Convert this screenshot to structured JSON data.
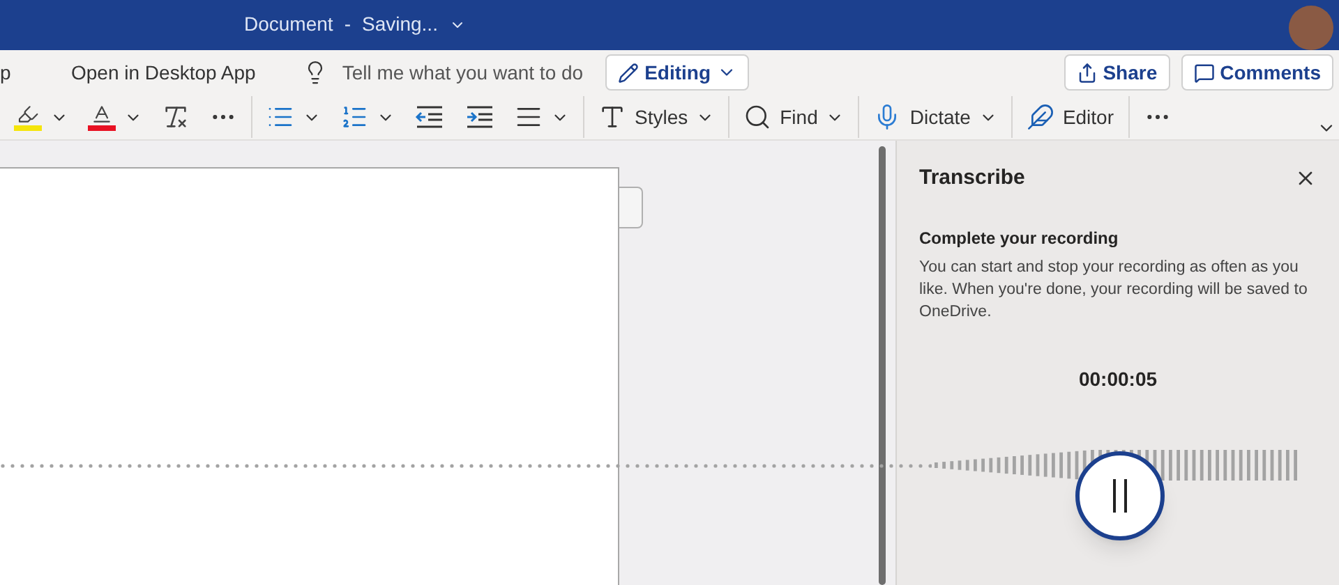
{
  "title_bar": {
    "document": "Document",
    "separator": "-",
    "status": "Saving..."
  },
  "ribbon": {
    "cut_tab": "p",
    "open_desktop": "Open in Desktop App",
    "tell_me": "Tell me what you want to do",
    "mode": "Editing",
    "share": "Share",
    "comments": "Comments"
  },
  "toolbar": {
    "groups": [
      [
        {
          "kind": "highlight",
          "dropdown": true
        },
        {
          "kind": "font-color",
          "dropdown": true
        },
        {
          "kind": "clear-format",
          "dropdown": false
        },
        {
          "kind": "more",
          "dropdown": false
        }
      ],
      [
        {
          "kind": "bullets",
          "dropdown": true
        },
        {
          "kind": "numbering",
          "dropdown": true
        },
        {
          "kind": "outdent",
          "dropdown": false
        },
        {
          "kind": "indent",
          "dropdown": false
        },
        {
          "kind": "align",
          "dropdown": true
        }
      ],
      [
        {
          "kind": "styles",
          "label": "Styles",
          "dropdown": true
        }
      ],
      [
        {
          "kind": "find",
          "label": "Find",
          "dropdown": true
        }
      ],
      [
        {
          "kind": "dictate",
          "label": "Dictate",
          "dropdown": true
        }
      ],
      [
        {
          "kind": "editor",
          "label": "Editor",
          "dropdown": false
        }
      ],
      [
        {
          "kind": "more",
          "dropdown": false
        }
      ]
    ]
  },
  "transcribe": {
    "title": "Transcribe",
    "heading": "Complete your recording",
    "body": "You can start and stop your recording as often as you like. When you're done, your recording will be saved to OneDrive.",
    "timer": "00:00:05",
    "recording": true
  }
}
